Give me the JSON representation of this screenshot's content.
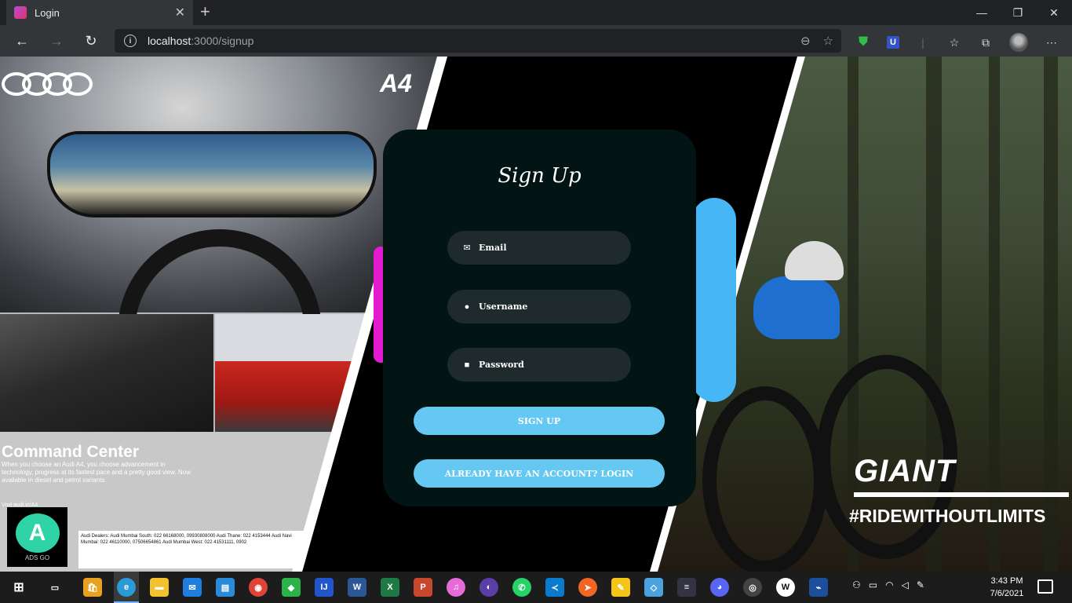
{
  "browser": {
    "tab_title": "Login",
    "url_host": "localhost",
    "url_path": ":3000/signup",
    "win_minimize": "—",
    "win_restore": "❐",
    "win_close": "✕"
  },
  "ads_left": {
    "brand_model": "A4",
    "headline": "Command Center",
    "description": "When you choose an Audi A4, you choose advancement in technology, progress at its fastest pace and a pretty good view. Now available in diesel and petrol variants.",
    "visit": "Visit audi.in/A4",
    "fineprint": "Audi Dealers: Audi Mumbai South: 022 66168000, 09930808000 Audi Thane: 022 4153444 Audi Navi Mumbai: 022 46110000, 07506654861 Audi Mumbai West: 022 41531111, 0902",
    "badge_text": "ADS GO"
  },
  "ads_right": {
    "brand": "GIANT",
    "tagline": "#RIDEWITHOUTLIMITS"
  },
  "signup": {
    "title": "Sign Up",
    "email_placeholder": "Email",
    "username_placeholder": "Username",
    "password_placeholder": "Password",
    "signup_button": "SIGN UP",
    "login_button": "ALREADY HAVE AN ACCOUNT? LOGIN"
  },
  "taskbar": {
    "time": "3:43 PM",
    "date": "7/6/2021"
  },
  "colors": {
    "card_bg": "#031415",
    "field_bg": "#1e2a2b",
    "button_bg": "#64c8f2"
  }
}
